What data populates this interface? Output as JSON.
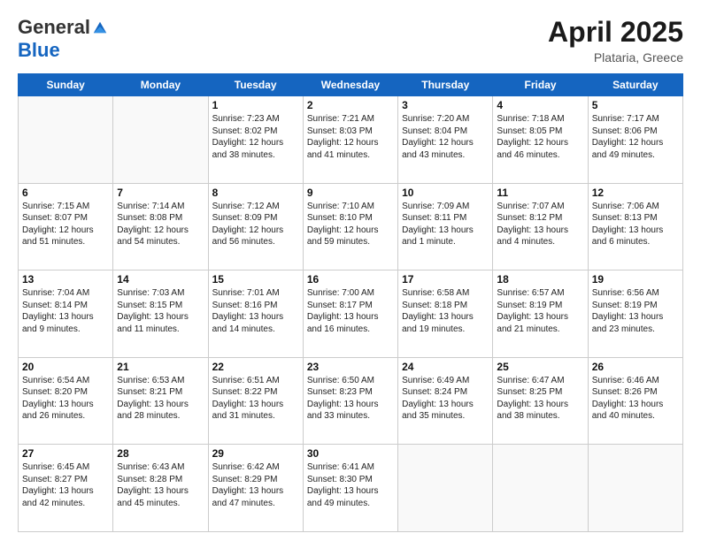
{
  "header": {
    "logo_general": "General",
    "logo_blue": "Blue",
    "month_title": "April 2025",
    "location": "Plataria, Greece"
  },
  "days_of_week": [
    "Sunday",
    "Monday",
    "Tuesday",
    "Wednesday",
    "Thursday",
    "Friday",
    "Saturday"
  ],
  "weeks": [
    [
      {
        "day": "",
        "sunrise": "",
        "sunset": "",
        "daylight": ""
      },
      {
        "day": "",
        "sunrise": "",
        "sunset": "",
        "daylight": ""
      },
      {
        "day": "1",
        "sunrise": "Sunrise: 7:23 AM",
        "sunset": "Sunset: 8:02 PM",
        "daylight": "Daylight: 12 hours and 38 minutes."
      },
      {
        "day": "2",
        "sunrise": "Sunrise: 7:21 AM",
        "sunset": "Sunset: 8:03 PM",
        "daylight": "Daylight: 12 hours and 41 minutes."
      },
      {
        "day": "3",
        "sunrise": "Sunrise: 7:20 AM",
        "sunset": "Sunset: 8:04 PM",
        "daylight": "Daylight: 12 hours and 43 minutes."
      },
      {
        "day": "4",
        "sunrise": "Sunrise: 7:18 AM",
        "sunset": "Sunset: 8:05 PM",
        "daylight": "Daylight: 12 hours and 46 minutes."
      },
      {
        "day": "5",
        "sunrise": "Sunrise: 7:17 AM",
        "sunset": "Sunset: 8:06 PM",
        "daylight": "Daylight: 12 hours and 49 minutes."
      }
    ],
    [
      {
        "day": "6",
        "sunrise": "Sunrise: 7:15 AM",
        "sunset": "Sunset: 8:07 PM",
        "daylight": "Daylight: 12 hours and 51 minutes."
      },
      {
        "day": "7",
        "sunrise": "Sunrise: 7:14 AM",
        "sunset": "Sunset: 8:08 PM",
        "daylight": "Daylight: 12 hours and 54 minutes."
      },
      {
        "day": "8",
        "sunrise": "Sunrise: 7:12 AM",
        "sunset": "Sunset: 8:09 PM",
        "daylight": "Daylight: 12 hours and 56 minutes."
      },
      {
        "day": "9",
        "sunrise": "Sunrise: 7:10 AM",
        "sunset": "Sunset: 8:10 PM",
        "daylight": "Daylight: 12 hours and 59 minutes."
      },
      {
        "day": "10",
        "sunrise": "Sunrise: 7:09 AM",
        "sunset": "Sunset: 8:11 PM",
        "daylight": "Daylight: 13 hours and 1 minute."
      },
      {
        "day": "11",
        "sunrise": "Sunrise: 7:07 AM",
        "sunset": "Sunset: 8:12 PM",
        "daylight": "Daylight: 13 hours and 4 minutes."
      },
      {
        "day": "12",
        "sunrise": "Sunrise: 7:06 AM",
        "sunset": "Sunset: 8:13 PM",
        "daylight": "Daylight: 13 hours and 6 minutes."
      }
    ],
    [
      {
        "day": "13",
        "sunrise": "Sunrise: 7:04 AM",
        "sunset": "Sunset: 8:14 PM",
        "daylight": "Daylight: 13 hours and 9 minutes."
      },
      {
        "day": "14",
        "sunrise": "Sunrise: 7:03 AM",
        "sunset": "Sunset: 8:15 PM",
        "daylight": "Daylight: 13 hours and 11 minutes."
      },
      {
        "day": "15",
        "sunrise": "Sunrise: 7:01 AM",
        "sunset": "Sunset: 8:16 PM",
        "daylight": "Daylight: 13 hours and 14 minutes."
      },
      {
        "day": "16",
        "sunrise": "Sunrise: 7:00 AM",
        "sunset": "Sunset: 8:17 PM",
        "daylight": "Daylight: 13 hours and 16 minutes."
      },
      {
        "day": "17",
        "sunrise": "Sunrise: 6:58 AM",
        "sunset": "Sunset: 8:18 PM",
        "daylight": "Daylight: 13 hours and 19 minutes."
      },
      {
        "day": "18",
        "sunrise": "Sunrise: 6:57 AM",
        "sunset": "Sunset: 8:19 PM",
        "daylight": "Daylight: 13 hours and 21 minutes."
      },
      {
        "day": "19",
        "sunrise": "Sunrise: 6:56 AM",
        "sunset": "Sunset: 8:19 PM",
        "daylight": "Daylight: 13 hours and 23 minutes."
      }
    ],
    [
      {
        "day": "20",
        "sunrise": "Sunrise: 6:54 AM",
        "sunset": "Sunset: 8:20 PM",
        "daylight": "Daylight: 13 hours and 26 minutes."
      },
      {
        "day": "21",
        "sunrise": "Sunrise: 6:53 AM",
        "sunset": "Sunset: 8:21 PM",
        "daylight": "Daylight: 13 hours and 28 minutes."
      },
      {
        "day": "22",
        "sunrise": "Sunrise: 6:51 AM",
        "sunset": "Sunset: 8:22 PM",
        "daylight": "Daylight: 13 hours and 31 minutes."
      },
      {
        "day": "23",
        "sunrise": "Sunrise: 6:50 AM",
        "sunset": "Sunset: 8:23 PM",
        "daylight": "Daylight: 13 hours and 33 minutes."
      },
      {
        "day": "24",
        "sunrise": "Sunrise: 6:49 AM",
        "sunset": "Sunset: 8:24 PM",
        "daylight": "Daylight: 13 hours and 35 minutes."
      },
      {
        "day": "25",
        "sunrise": "Sunrise: 6:47 AM",
        "sunset": "Sunset: 8:25 PM",
        "daylight": "Daylight: 13 hours and 38 minutes."
      },
      {
        "day": "26",
        "sunrise": "Sunrise: 6:46 AM",
        "sunset": "Sunset: 8:26 PM",
        "daylight": "Daylight: 13 hours and 40 minutes."
      }
    ],
    [
      {
        "day": "27",
        "sunrise": "Sunrise: 6:45 AM",
        "sunset": "Sunset: 8:27 PM",
        "daylight": "Daylight: 13 hours and 42 minutes."
      },
      {
        "day": "28",
        "sunrise": "Sunrise: 6:43 AM",
        "sunset": "Sunset: 8:28 PM",
        "daylight": "Daylight: 13 hours and 45 minutes."
      },
      {
        "day": "29",
        "sunrise": "Sunrise: 6:42 AM",
        "sunset": "Sunset: 8:29 PM",
        "daylight": "Daylight: 13 hours and 47 minutes."
      },
      {
        "day": "30",
        "sunrise": "Sunrise: 6:41 AM",
        "sunset": "Sunset: 8:30 PM",
        "daylight": "Daylight: 13 hours and 49 minutes."
      },
      {
        "day": "",
        "sunrise": "",
        "sunset": "",
        "daylight": ""
      },
      {
        "day": "",
        "sunrise": "",
        "sunset": "",
        "daylight": ""
      },
      {
        "day": "",
        "sunrise": "",
        "sunset": "",
        "daylight": ""
      }
    ]
  ]
}
